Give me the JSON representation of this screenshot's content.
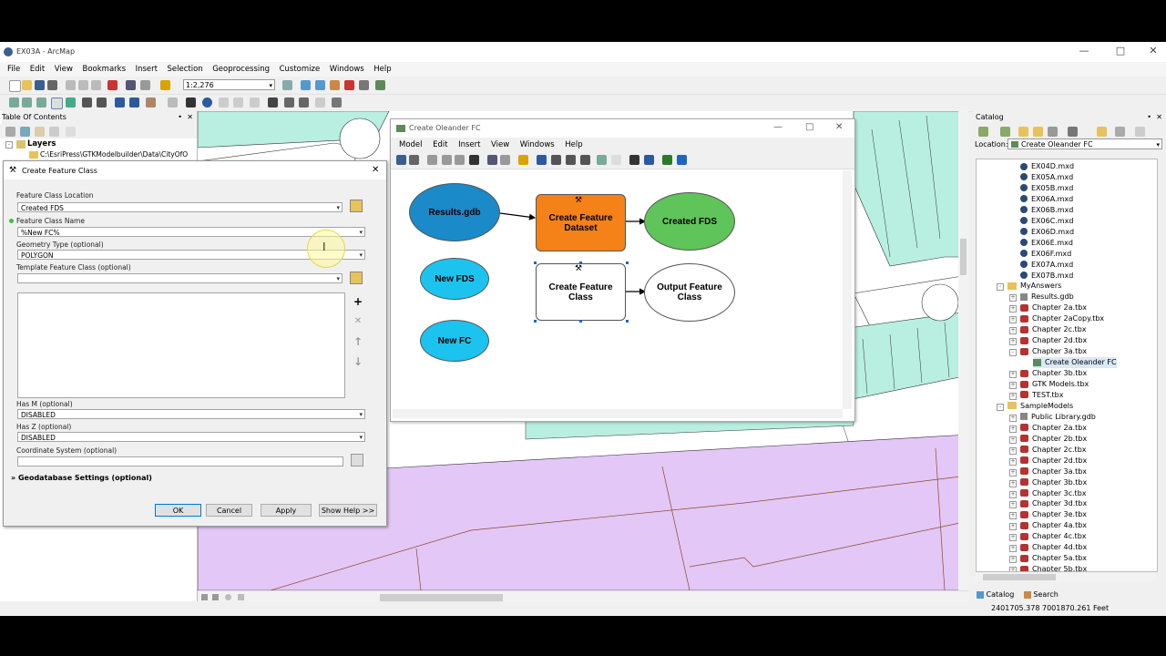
{
  "window": {
    "title": "EX03A - ArcMap"
  },
  "menu": [
    "File",
    "Edit",
    "View",
    "Bookmarks",
    "Insert",
    "Selection",
    "Geoprocessing",
    "Customize",
    "Windows",
    "Help"
  ],
  "toolbar": {
    "scale": "1:2,276"
  },
  "toc": {
    "title": "Table Of Contents",
    "layers": "Layers",
    "path": "C:\\EsriPress\\GTKModelbuilder\\Data\\CityOfO"
  },
  "dialog": {
    "title": "Create Feature Class",
    "location_label": "Feature Class Location",
    "location_value": "Created FDS",
    "name_label": "Feature Class Name",
    "name_value": "%New FC%",
    "geom_label": "Geometry Type (optional)",
    "geom_value": "POLYGON",
    "template_label": "Template Feature Class (optional)",
    "template_value": "",
    "hasm_label": "Has M (optional)",
    "hasm_value": "DISABLED",
    "hasz_label": "Has Z (optional)",
    "hasz_value": "DISABLED",
    "coord_label": "Coordinate System (optional)",
    "coord_value": "",
    "gdb_settings": "Geodatabase Settings (optional)",
    "ok": "OK",
    "cancel": "Cancel",
    "apply": "Apply",
    "show_help": "Show Help >>"
  },
  "model": {
    "title": "Create Oleander FC",
    "menu": [
      "Model",
      "Edit",
      "Insert",
      "View",
      "Windows",
      "Help"
    ],
    "nodes": {
      "results_gdb": "Results.gdb",
      "create_dataset": "Create Feature Dataset",
      "created_fds": "Created FDS",
      "new_fds": "New FDS",
      "new_fc": "New FC",
      "create_fc": "Create Feature Class",
      "output_fc": "Output Feature Class"
    },
    "colors": {
      "blue_dark": "#1a8ac8",
      "cyan": "#1cc3ee",
      "orange": "#f58218",
      "green": "#5fc45a"
    }
  },
  "catalog": {
    "title": "Catalog",
    "location_label": "Location:",
    "location_value": "Create Oleander FC",
    "items": [
      {
        "label": "EX04D.mxd",
        "type": "mxd",
        "level": 3
      },
      {
        "label": "EX05A.mxd",
        "type": "mxd",
        "level": 3
      },
      {
        "label": "EX05B.mxd",
        "type": "mxd",
        "level": 3
      },
      {
        "label": "EX06A.mxd",
        "type": "mxd",
        "level": 3
      },
      {
        "label": "EX06B.mxd",
        "type": "mxd",
        "level": 3
      },
      {
        "label": "EX06C.mxd",
        "type": "mxd",
        "level": 3
      },
      {
        "label": "EX06D.mxd",
        "type": "mxd",
        "level": 3
      },
      {
        "label": "EX06E.mxd",
        "type": "mxd",
        "level": 3
      },
      {
        "label": "EX06F.mxd",
        "type": "mxd",
        "level": 3
      },
      {
        "label": "EX07A.mxd",
        "type": "mxd",
        "level": 3
      },
      {
        "label": "EX07B.mxd",
        "type": "mxd",
        "level": 3
      },
      {
        "label": "MyAnswers",
        "type": "folder",
        "level": 2
      },
      {
        "label": "Results.gdb",
        "type": "gdb",
        "level": 3
      },
      {
        "label": "Chapter 2a.tbx",
        "type": "tbx",
        "level": 3
      },
      {
        "label": "Chapter 2aCopy.tbx",
        "type": "tbx",
        "level": 3
      },
      {
        "label": "Chapter 2c.tbx",
        "type": "tbx",
        "level": 3
      },
      {
        "label": "Chapter 2d.tbx",
        "type": "tbx",
        "level": 3
      },
      {
        "label": "Chapter 3a.tbx",
        "type": "tbx",
        "level": 3
      },
      {
        "label": "Create Oleander FC",
        "type": "model",
        "level": 4
      },
      {
        "label": "Chapter 3b.tbx",
        "type": "tbx",
        "level": 3
      },
      {
        "label": "GTK Models.tbx",
        "type": "tbx",
        "level": 3
      },
      {
        "label": "TEST.tbx",
        "type": "tbx",
        "level": 3
      },
      {
        "label": "SampleModels",
        "type": "folder",
        "level": 2
      },
      {
        "label": "Public Library.gdb",
        "type": "gdb",
        "level": 3
      },
      {
        "label": "Chapter 2a.tbx",
        "type": "tbx",
        "level": 3
      },
      {
        "label": "Chapter 2b.tbx",
        "type": "tbx",
        "level": 3
      },
      {
        "label": "Chapter 2c.tbx",
        "type": "tbx",
        "level": 3
      },
      {
        "label": "Chapter 2d.tbx",
        "type": "tbx",
        "level": 3
      },
      {
        "label": "Chapter 3a.tbx",
        "type": "tbx",
        "level": 3
      },
      {
        "label": "Chapter 3b.tbx",
        "type": "tbx",
        "level": 3
      },
      {
        "label": "Chapter 3c.tbx",
        "type": "tbx",
        "level": 3
      },
      {
        "label": "Chapter 3d.tbx",
        "type": "tbx",
        "level": 3
      },
      {
        "label": "Chapter 3e.tbx",
        "type": "tbx",
        "level": 3
      },
      {
        "label": "Chapter 4a.tbx",
        "type": "tbx",
        "level": 3
      },
      {
        "label": "Chapter 4c.tbx",
        "type": "tbx",
        "level": 3
      },
      {
        "label": "Chapter 4d.tbx",
        "type": "tbx",
        "level": 3
      },
      {
        "label": "Chapter 5a.tbx",
        "type": "tbx",
        "level": 3
      },
      {
        "label": "Chapter 5b.tbx",
        "type": "tbx",
        "level": 3
      }
    ],
    "tab_catalog": "Catalog",
    "tab_search": "Search"
  },
  "status": {
    "coords": "2401705.378  7001870.261 Feet"
  }
}
